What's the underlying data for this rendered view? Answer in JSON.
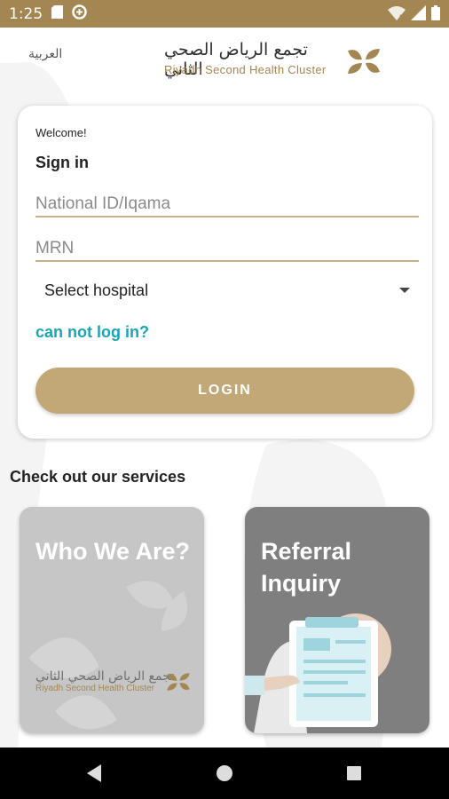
{
  "status_bar": {
    "time": "1:25"
  },
  "header": {
    "language_link": "العربية",
    "brand_arabic": "تجمع الرياض الصحي الثاني",
    "brand_english": "Riyadh  Second Health Cluster"
  },
  "login_card": {
    "welcome": "Welcome!",
    "title": "Sign in",
    "national_id_placeholder": "National ID/Iqama",
    "mrn_placeholder": "MRN",
    "hospital_select": "Select hospital",
    "cannot_login": "can not log in?",
    "login_button": "LOGIN"
  },
  "services": {
    "title": "Check out our services",
    "tiles": [
      {
        "label": "Who We Are?",
        "brand_arabic": "تجمع الرياض الصحي الثاني",
        "brand_english": "Riyadh  Second Health Cluster"
      },
      {
        "label": "Referral Inquiry"
      }
    ]
  },
  "colors": {
    "brand_gold": "#a38652",
    "button": "#c2a876",
    "link": "#1aa5b5",
    "tile_light": "#c6c6c6",
    "tile_dark": "#7f7f7f"
  }
}
